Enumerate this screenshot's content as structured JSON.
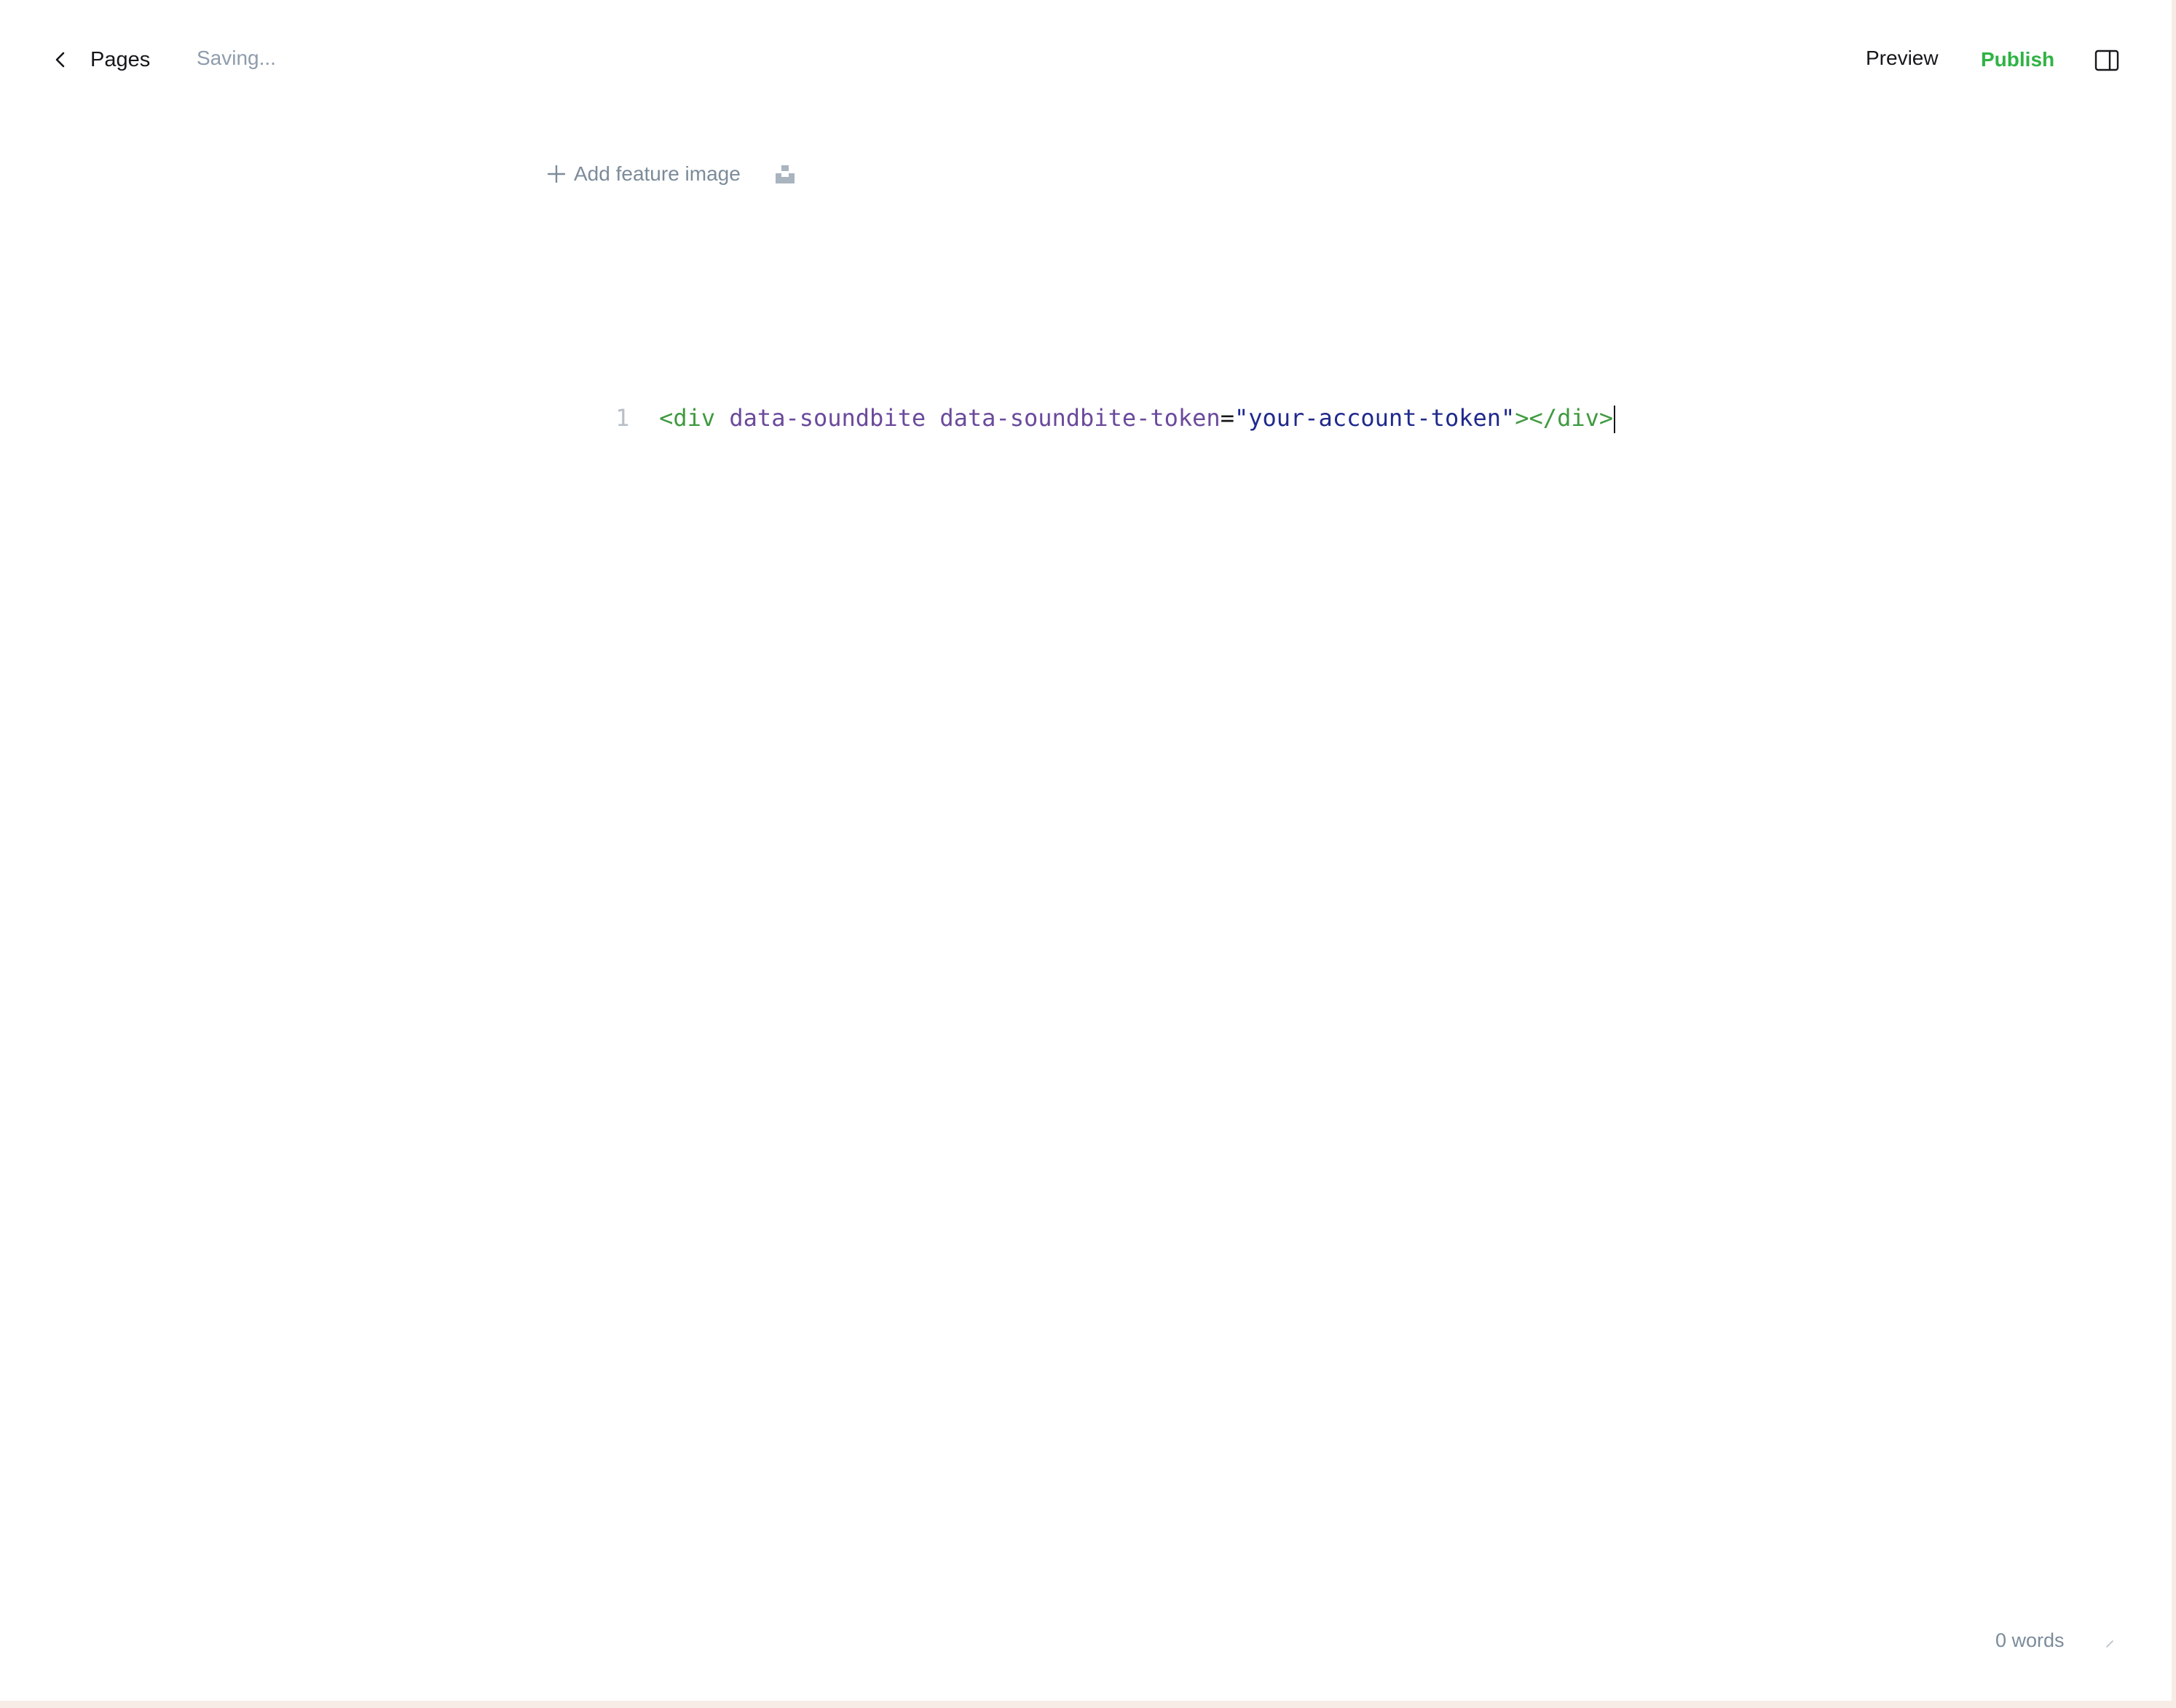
{
  "header": {
    "back_label": "Pages",
    "status": "Saving...",
    "preview_label": "Preview",
    "publish_label": "Publish"
  },
  "feature": {
    "add_label": "Add feature image"
  },
  "editor": {
    "line_number": "1",
    "tokens": {
      "open_tag": "<div",
      "attr1": "data-soundbite",
      "attr2": "data-soundbite-token",
      "equals": "=",
      "value": "\"your-account-token\"",
      "close": "></div>"
    }
  },
  "footer": {
    "word_count": "0 words"
  },
  "colors": {
    "publish": "#2fb344",
    "muted": "#8e9cac",
    "tag": "#3f9a3f",
    "attr": "#6b4a9c",
    "string": "#1f2a8c"
  },
  "icons": {
    "back": "chevron-left-icon",
    "add": "plus-icon",
    "unsplash": "unsplash-icon",
    "sidebar": "sidebar-toggle-icon"
  }
}
